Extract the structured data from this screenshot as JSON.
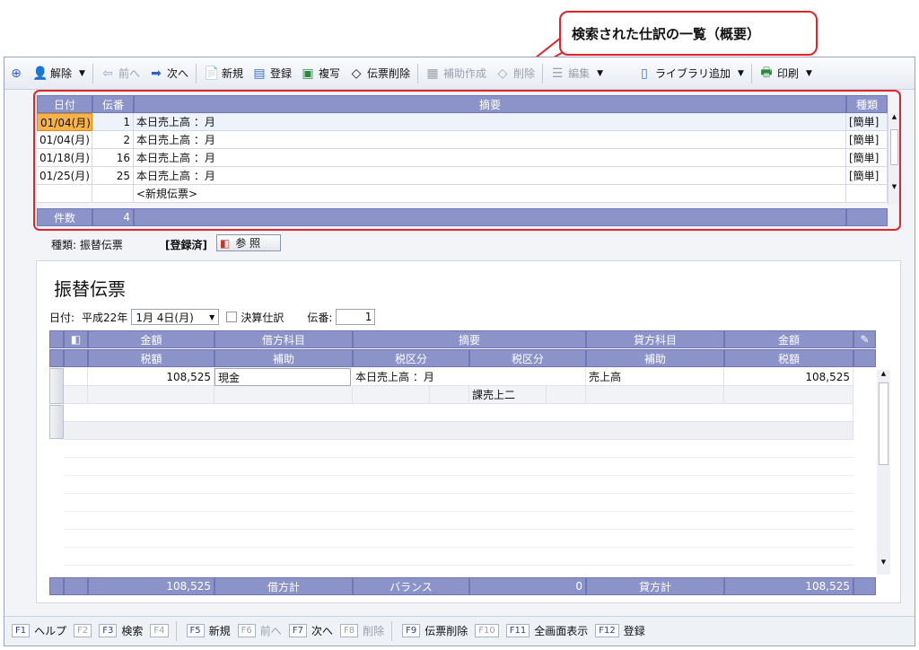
{
  "callout": {
    "text": "検索された仕訳の一覧（概要）"
  },
  "toolbar": {
    "unlock": "解除",
    "prev": "前へ",
    "next": "次へ",
    "new": "新規",
    "register": "登録",
    "copy": "複写",
    "delete_slip": "伝票削除",
    "aux_create": "補助作成",
    "delete": "削除",
    "edit": "編集",
    "library_add": "ライブラリ追加",
    "print": "印刷"
  },
  "list": {
    "headers": {
      "date": "日付",
      "num": "伝番",
      "summary": "摘要",
      "type": "種類"
    },
    "rows": [
      {
        "date": "01/04(月)",
        "num": "1",
        "summary": "本日売上高 ：月",
        "type": "[簡単]"
      },
      {
        "date": "01/04(月)",
        "num": "2",
        "summary": "本日売上高 ：月",
        "type": "[簡単]"
      },
      {
        "date": "01/18(月)",
        "num": "16",
        "summary": "本日売上高 ：月",
        "type": "[簡単]"
      },
      {
        "date": "01/25(月)",
        "num": "25",
        "summary": "本日売上高 ：月",
        "type": "[簡単]"
      }
    ],
    "new_slip": "<新規伝票>",
    "count_label": "件数",
    "count_value": "4"
  },
  "status": {
    "type_text": "種類: 振替伝票",
    "registered": "[登録済]",
    "ref_button": "参 照"
  },
  "slip": {
    "title": "振替伝票",
    "date_label": "日付:",
    "era": "平成22年",
    "date_value": "1月 4日(月)",
    "closing_label": "決算仕訳",
    "num_label": "伝番:",
    "num_value": "1",
    "headers": {
      "amount": "金額",
      "debit_account": "借方科目",
      "summary": "摘要",
      "credit_account": "貸方科目",
      "amount2": "金額",
      "tax_amount": "税額",
      "aux": "補助",
      "tax_class": "税区分",
      "tax_class2": "税区分",
      "aux2": "補助",
      "tax_amount2": "税額"
    },
    "row1": {
      "amount": "108,525",
      "debit": "現金",
      "summary": "本日売上高 ：月",
      "credit": "売上高",
      "amount2": "108,525"
    },
    "row2": {
      "tax_class2": "課売上二"
    },
    "footer": {
      "debit_total_value": "108,525",
      "debit_total_label": "借方計",
      "balance_label": "バランス",
      "balance_value": "0",
      "credit_total_label": "貸方計",
      "credit_total_value": "108,525"
    }
  },
  "fkeys": [
    {
      "key": "F1",
      "label": "ヘルプ",
      "enabled": true
    },
    {
      "key": "F2",
      "label": "",
      "enabled": false
    },
    {
      "key": "F3",
      "label": "検索",
      "enabled": true
    },
    {
      "key": "F4",
      "label": "",
      "enabled": false
    },
    {
      "key": "F5",
      "label": "新規",
      "enabled": true
    },
    {
      "key": "F6",
      "label": "前へ",
      "enabled": false
    },
    {
      "key": "F7",
      "label": "次へ",
      "enabled": true
    },
    {
      "key": "F8",
      "label": "削除",
      "enabled": false
    },
    {
      "key": "F9",
      "label": "伝票削除",
      "enabled": true
    },
    {
      "key": "F10",
      "label": "",
      "enabled": false
    },
    {
      "key": "F11",
      "label": "全画面表示",
      "enabled": true
    },
    {
      "key": "F12",
      "label": "登録",
      "enabled": true
    }
  ]
}
